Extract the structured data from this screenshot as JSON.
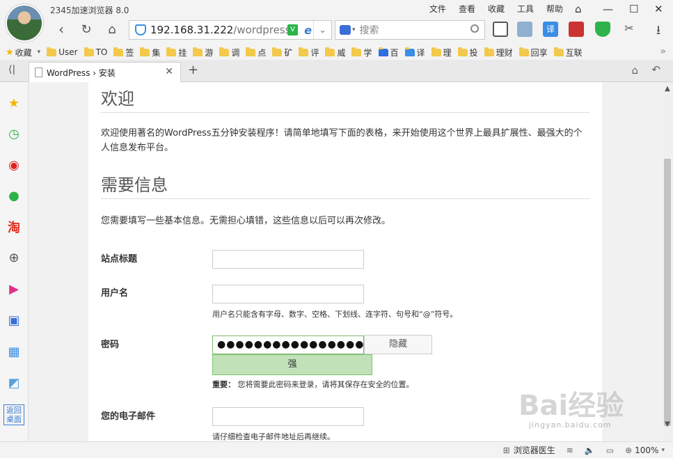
{
  "browser": {
    "app_title": "2345加速浏览器 8.0",
    "url_host": "192.168.31.222",
    "url_path": "/wordpress",
    "search_placeholder": "搜索",
    "menu": [
      "文件",
      "查看",
      "收藏",
      "工具",
      "帮助"
    ],
    "secure_badge": "V",
    "bookmarks_label": "收藏",
    "bookmarks": [
      "User",
      "TO",
      "签",
      "集",
      "挂",
      "游",
      "调",
      "点",
      "矿",
      "评",
      "威",
      "学",
      "百",
      "译",
      "理",
      "投",
      "理财",
      "回享",
      "互联"
    ],
    "tab_title": "WordPress › 安装",
    "return_desktop": "返回桌面",
    "status": {
      "doctor": "浏览器医生",
      "zoom": "100%"
    }
  },
  "page": {
    "welcome_heading": "欢迎",
    "welcome_text": "欢迎使用著名的WordPress五分钟安装程序！请简单地填写下面的表格，来开始使用这个世界上最具扩展性、最强大的个人信息发布平台。",
    "info_heading": "需要信息",
    "info_text": "您需要填写一些基本信息。无需担心填错，这些信息以后可以再次修改。",
    "site_title_label": "站点标题",
    "site_title_value": "",
    "username_label": "用户名",
    "username_value": "",
    "username_hint": "用户名只能含有字母、数字、空格、下划线、连字符、句号和“@”符号。",
    "password_label": "密码",
    "password_masked": "●●●●●●●●●●●●●●●●●●",
    "hide_button": "隐藏",
    "strength": "强",
    "important_label": "重要：",
    "important_text": "您将需要此密码来登录，请将其保存在安全的位置。",
    "email_label": "您的电子邮件",
    "email_value": "",
    "email_hint": "请仔细检查电子邮件地址后再继续。"
  },
  "watermark": {
    "main": "Bai经验",
    "sub": "jingyan.baidu.com"
  }
}
